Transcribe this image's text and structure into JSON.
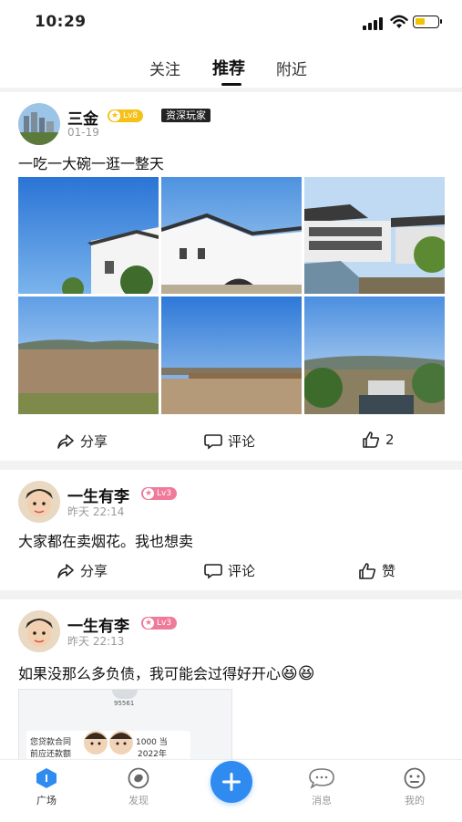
{
  "status": {
    "time": "10:29"
  },
  "tabs": [
    {
      "label": "关注"
    },
    {
      "label": "推荐"
    },
    {
      "label": "附近"
    }
  ],
  "posts": [
    {
      "name": "三金",
      "level": "Lv8",
      "tag": "资深玩家",
      "time": "01-19",
      "text": "一吃一大碗一逛一整天",
      "actions": {
        "share": "分享",
        "comment": "评论",
        "like": "2"
      }
    },
    {
      "name": "一生有李",
      "level": "Lv3",
      "time": "昨天 22:14",
      "text": "大家都在卖烟花。我也想卖",
      "actions": {
        "share": "分享",
        "comment": "评论",
        "like": "赞"
      }
    },
    {
      "name": "一生有李",
      "level": "Lv3",
      "time": "昨天 22:13",
      "text": "如果没那么多负债，我可能会过得好开心",
      "emoji": "😆😆",
      "screenshot": {
        "number": "95561",
        "line1": "您贷款合同",
        "line2": "前应还款额",
        "amount": "1000 当",
        "year": "2022年"
      }
    }
  ],
  "bottom_nav": [
    {
      "label": "广场",
      "icon": "hexagon-home-icon",
      "active": true
    },
    {
      "label": "发现",
      "icon": "discover-icon"
    },
    {
      "label": "",
      "icon": "plus-icon"
    },
    {
      "label": "消息",
      "icon": "message-icon"
    },
    {
      "label": "我的",
      "icon": "profile-icon"
    }
  ],
  "colors": {
    "accent": "#2f8bf0",
    "lv8": "#f5c118",
    "lv3": "#f07a9a"
  }
}
